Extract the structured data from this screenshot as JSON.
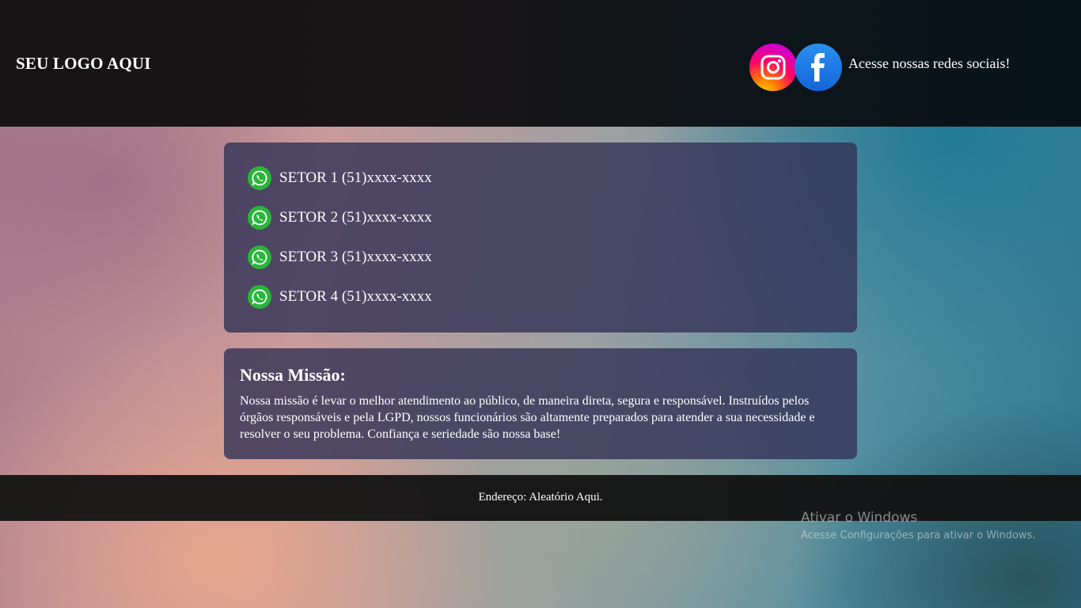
{
  "header": {
    "logo": "SEU LOGO AQUI",
    "social_text": "Acesse nossas redes sociais!",
    "social_icons": [
      "instagram-icon",
      "facebook-icon"
    ]
  },
  "contacts": [
    {
      "label": "SETOR 1 (51)xxxx-xxxx",
      "icon": "whatsapp-icon"
    },
    {
      "label": "SETOR 2 (51)xxxx-xxxx",
      "icon": "whatsapp-icon"
    },
    {
      "label": "SETOR 3 (51)xxxx-xxxx",
      "icon": "whatsapp-icon"
    },
    {
      "label": "SETOR 4 (51)xxxx-xxxx",
      "icon": "whatsapp-icon"
    }
  ],
  "mission": {
    "title": "Nossa Missão:",
    "text": "Nossa missão é levar o melhor atendimento ao público, de maneira direta, segura e responsável. Instruídos pelos órgãos responsáveis e pela LGPD, nossos funcionários são altamente preparados para atender a sua necessidade e resolver o seu problema. Confiança e seriedade são nossa base!"
  },
  "footer": {
    "address": "Endereço: Aleatório Aqui."
  },
  "watermark": {
    "title": "Ativar o Windows",
    "subtitle": "Acesse Configurações para ativar o Windows."
  },
  "colors": {
    "whatsapp": "#29b53a",
    "facebook": "#1877f2",
    "card_bg": "#343458",
    "header_bg": "#181416"
  }
}
